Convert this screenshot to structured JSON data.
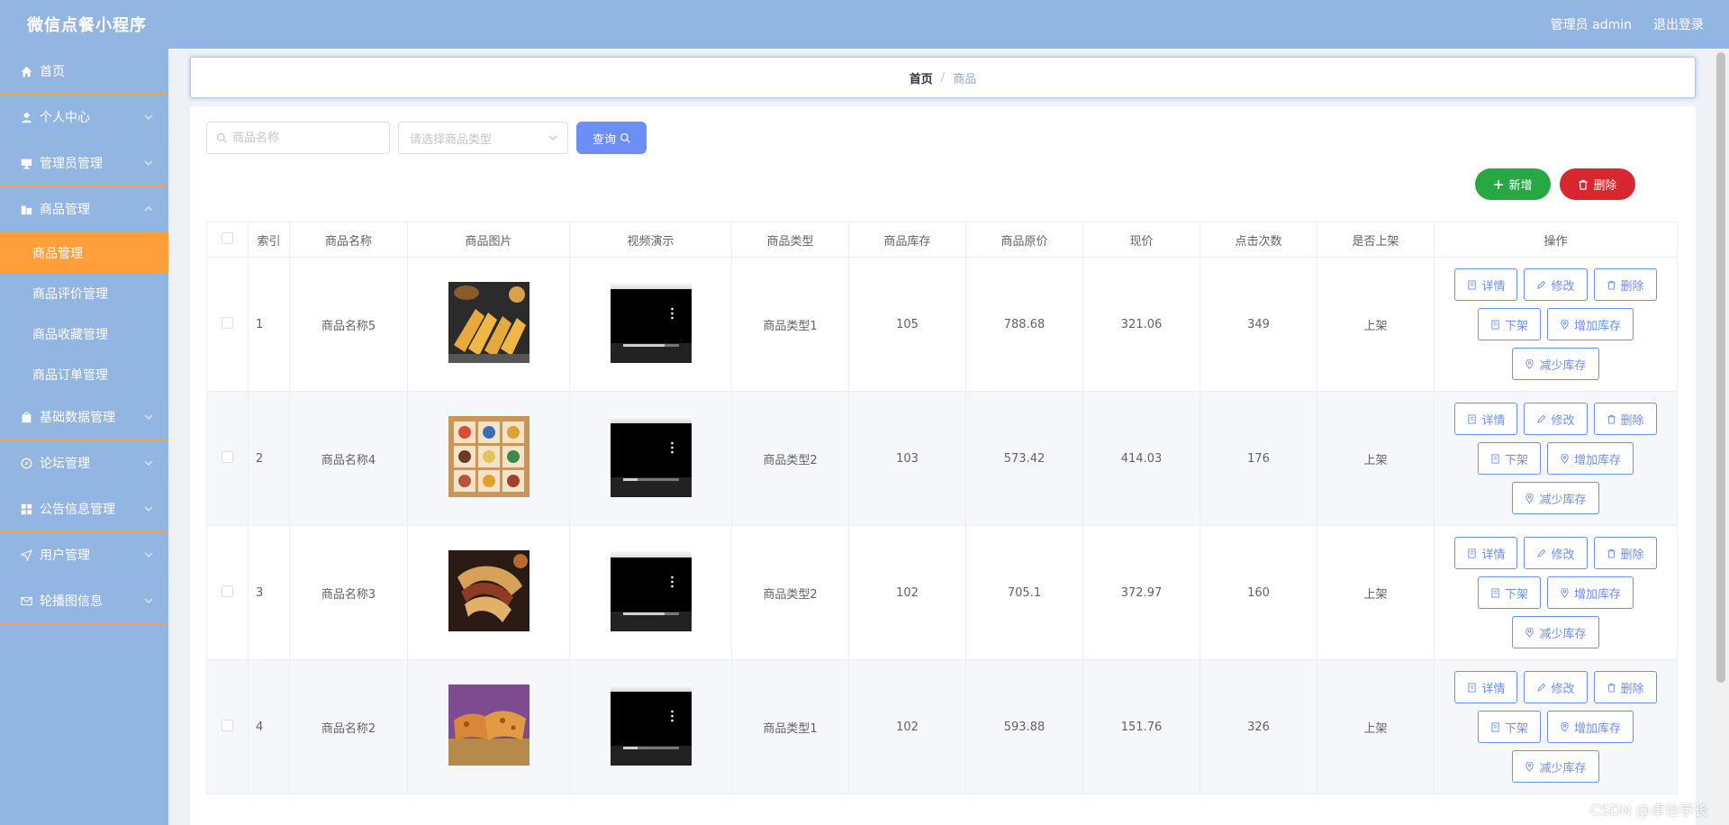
{
  "app": {
    "title": "微信点餐小程序"
  },
  "header": {
    "admin_label": "管理员 admin",
    "logout_label": "退出登录"
  },
  "sidebar": {
    "items": [
      {
        "label": "首页",
        "icon": "home-icon"
      },
      {
        "label": "个人中心",
        "icon": "user-icon"
      },
      {
        "label": "管理员管理",
        "icon": "monitor-icon"
      },
      {
        "label": "商品管理",
        "icon": "goods-icon"
      },
      {
        "label": "基础数据管理",
        "icon": "bag-icon"
      },
      {
        "label": "论坛管理",
        "icon": "compass-icon"
      },
      {
        "label": "公告信息管理",
        "icon": "grid-icon"
      },
      {
        "label": "用户管理",
        "icon": "send-icon"
      },
      {
        "label": "轮播图信息",
        "icon": "mail-icon"
      }
    ],
    "submenu": [
      {
        "label": "商品管理"
      },
      {
        "label": "商品评价管理"
      },
      {
        "label": "商品收藏管理"
      },
      {
        "label": "商品订单管理"
      }
    ]
  },
  "breadcrumb": {
    "home": "首页",
    "separator": "/",
    "current": "商品"
  },
  "search": {
    "name_placeholder": "商品名称",
    "type_placeholder": "请选择商品类型",
    "query_label": "查询"
  },
  "actions": {
    "add_label": "新增",
    "delete_label": "删除"
  },
  "table": {
    "headers": [
      "索引",
      "商品名称",
      "商品图片",
      "视频演示",
      "商品类型",
      "商品库存",
      "商品原价",
      "现价",
      "点击次数",
      "是否上架",
      "操作"
    ],
    "rows": [
      {
        "index": "1",
        "name": "商品名称5",
        "type": "商品类型1",
        "stock": "105",
        "orig_price": "788.68",
        "price": "321.06",
        "clicks": "349",
        "status": "上架"
      },
      {
        "index": "2",
        "name": "商品名称4",
        "type": "商品类型2",
        "stock": "103",
        "orig_price": "573.42",
        "price": "414.03",
        "clicks": "176",
        "status": "上架"
      },
      {
        "index": "3",
        "name": "商品名称3",
        "type": "商品类型2",
        "stock": "102",
        "orig_price": "705.1",
        "price": "372.97",
        "clicks": "160",
        "status": "上架"
      },
      {
        "index": "4",
        "name": "商品名称2",
        "type": "商品类型1",
        "stock": "102",
        "orig_price": "593.88",
        "price": "151.76",
        "clicks": "326",
        "status": "上架"
      }
    ],
    "row_actions": {
      "detail": "详情",
      "edit": "修改",
      "delete": "删除",
      "unlist": "下架",
      "add_stock": "增加库存",
      "reduce_stock": "减少库存"
    }
  },
  "watermark": "CSDN @卓怡学长",
  "colors": {
    "header_bg": "#93b5e2",
    "sidebar_active": "#ff9f3b",
    "primary": "#6b8ef7",
    "add_green": "#28a745",
    "delete_red": "#d9262f"
  }
}
